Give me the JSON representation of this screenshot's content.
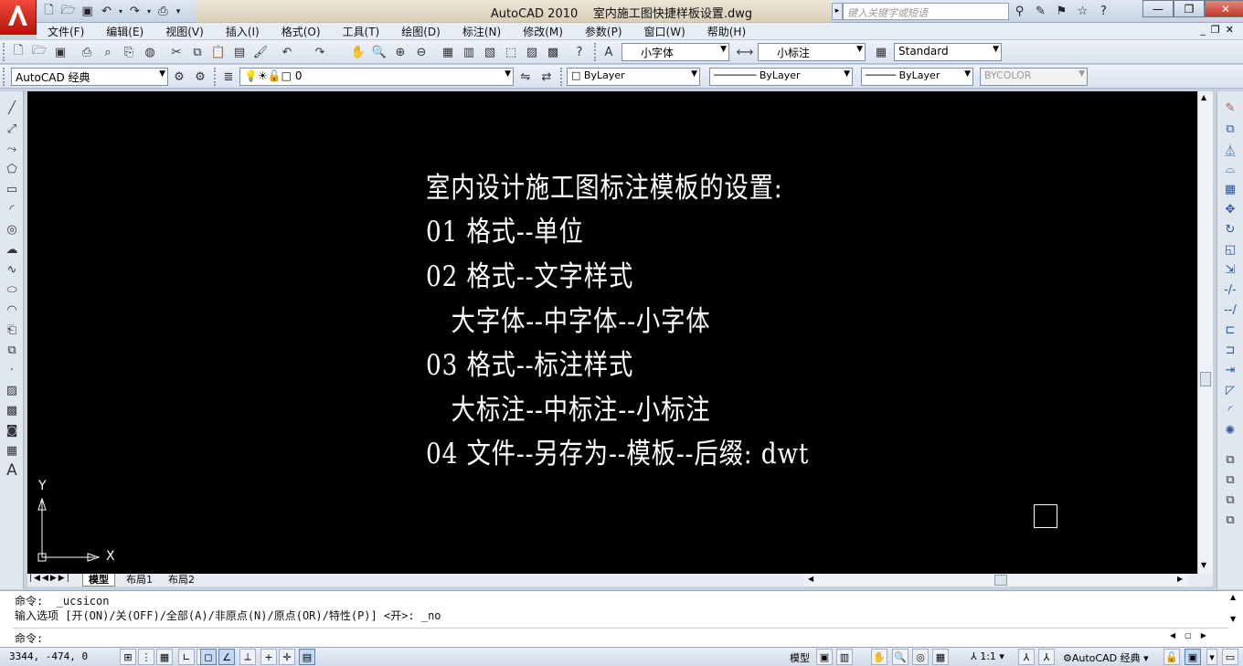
{
  "window": {
    "app_name": "AutoCAD 2010",
    "file_name": "室内施工图快捷样板设置.dwg",
    "search_placeholder": "键入关键字或短语"
  },
  "menu": [
    "文件(F)",
    "编辑(E)",
    "视图(V)",
    "插入(I)",
    "格式(O)",
    "工具(T)",
    "绘图(D)",
    "标注(N)",
    "修改(M)",
    "参数(P)",
    "窗口(W)",
    "帮助(H)"
  ],
  "styles_toolbar": {
    "text_style": "小字体",
    "dim_style": "小标注",
    "table_style": "Standard"
  },
  "layers_toolbar": {
    "workspace": "AutoCAD 经典",
    "layer": "0",
    "color": "ByLayer",
    "linetype": "ByLayer",
    "lineweight": "ByLayer",
    "plot_style": "BYCOLOR"
  },
  "drawing_text": [
    "室内设计施工图标注模板的设置:",
    "01 格式--单位",
    "02 格式--文字样式",
    "   大字体--中字体--小字体",
    "03 格式--标注样式",
    "   大标注--中标注--小标注",
    "04 文件--另存为--模板--后缀: dwt"
  ],
  "ucs": {
    "x_label": "X",
    "y_label": "Y"
  },
  "layout_tabs": [
    "模型",
    "布局1",
    "布局2"
  ],
  "command": {
    "line1": "命令:  _ucsicon",
    "line2": "输入选项 [开(ON)/关(OFF)/全部(A)/非原点(N)/原点(OR)/特性(P)] <开>: _no",
    "prompt": "命令:"
  },
  "status": {
    "coordinates": "3344, -474, 0",
    "model_label": "模型",
    "annotation_scale": "1:1",
    "workspace": "AutoCAD 经典"
  },
  "colors": {
    "canvas": "#000000",
    "drawing_text": "#ffffff",
    "app_button": "#d7261b"
  }
}
